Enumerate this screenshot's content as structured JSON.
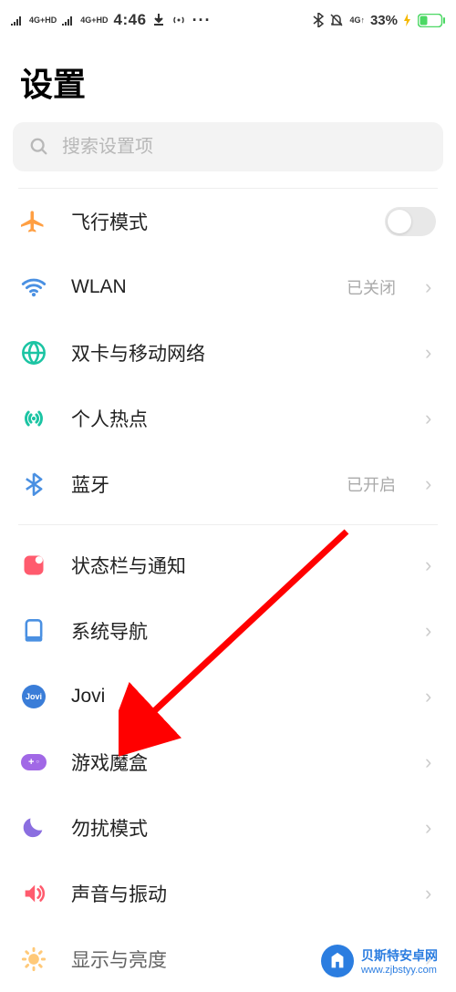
{
  "statusbar": {
    "sig1": "4G+HD",
    "sig2": "4G+HD",
    "time": "4:46",
    "net_indicator": "4G↑",
    "battery_pct": "33%"
  },
  "header": {
    "title": "设置"
  },
  "search": {
    "placeholder": "搜索设置项"
  },
  "items": {
    "airplane": {
      "label": "飞行模式"
    },
    "wlan": {
      "label": "WLAN",
      "value": "已关闭"
    },
    "sim": {
      "label": "双卡与移动网络"
    },
    "hotspot": {
      "label": "个人热点"
    },
    "bluetooth": {
      "label": "蓝牙",
      "value": "已开启"
    },
    "statusnotif": {
      "label": "状态栏与通知"
    },
    "sysnav": {
      "label": "系统导航"
    },
    "jovi": {
      "label": "Jovi",
      "icon_text": "Jovi"
    },
    "gamebox": {
      "label": "游戏魔盒"
    },
    "dnd": {
      "label": "勿扰模式"
    },
    "sound": {
      "label": "声音与振动"
    },
    "display": {
      "label": "显示与亮度"
    }
  },
  "watermark": {
    "title": "贝斯特安卓网",
    "url": "www.zjbstyy.com"
  }
}
